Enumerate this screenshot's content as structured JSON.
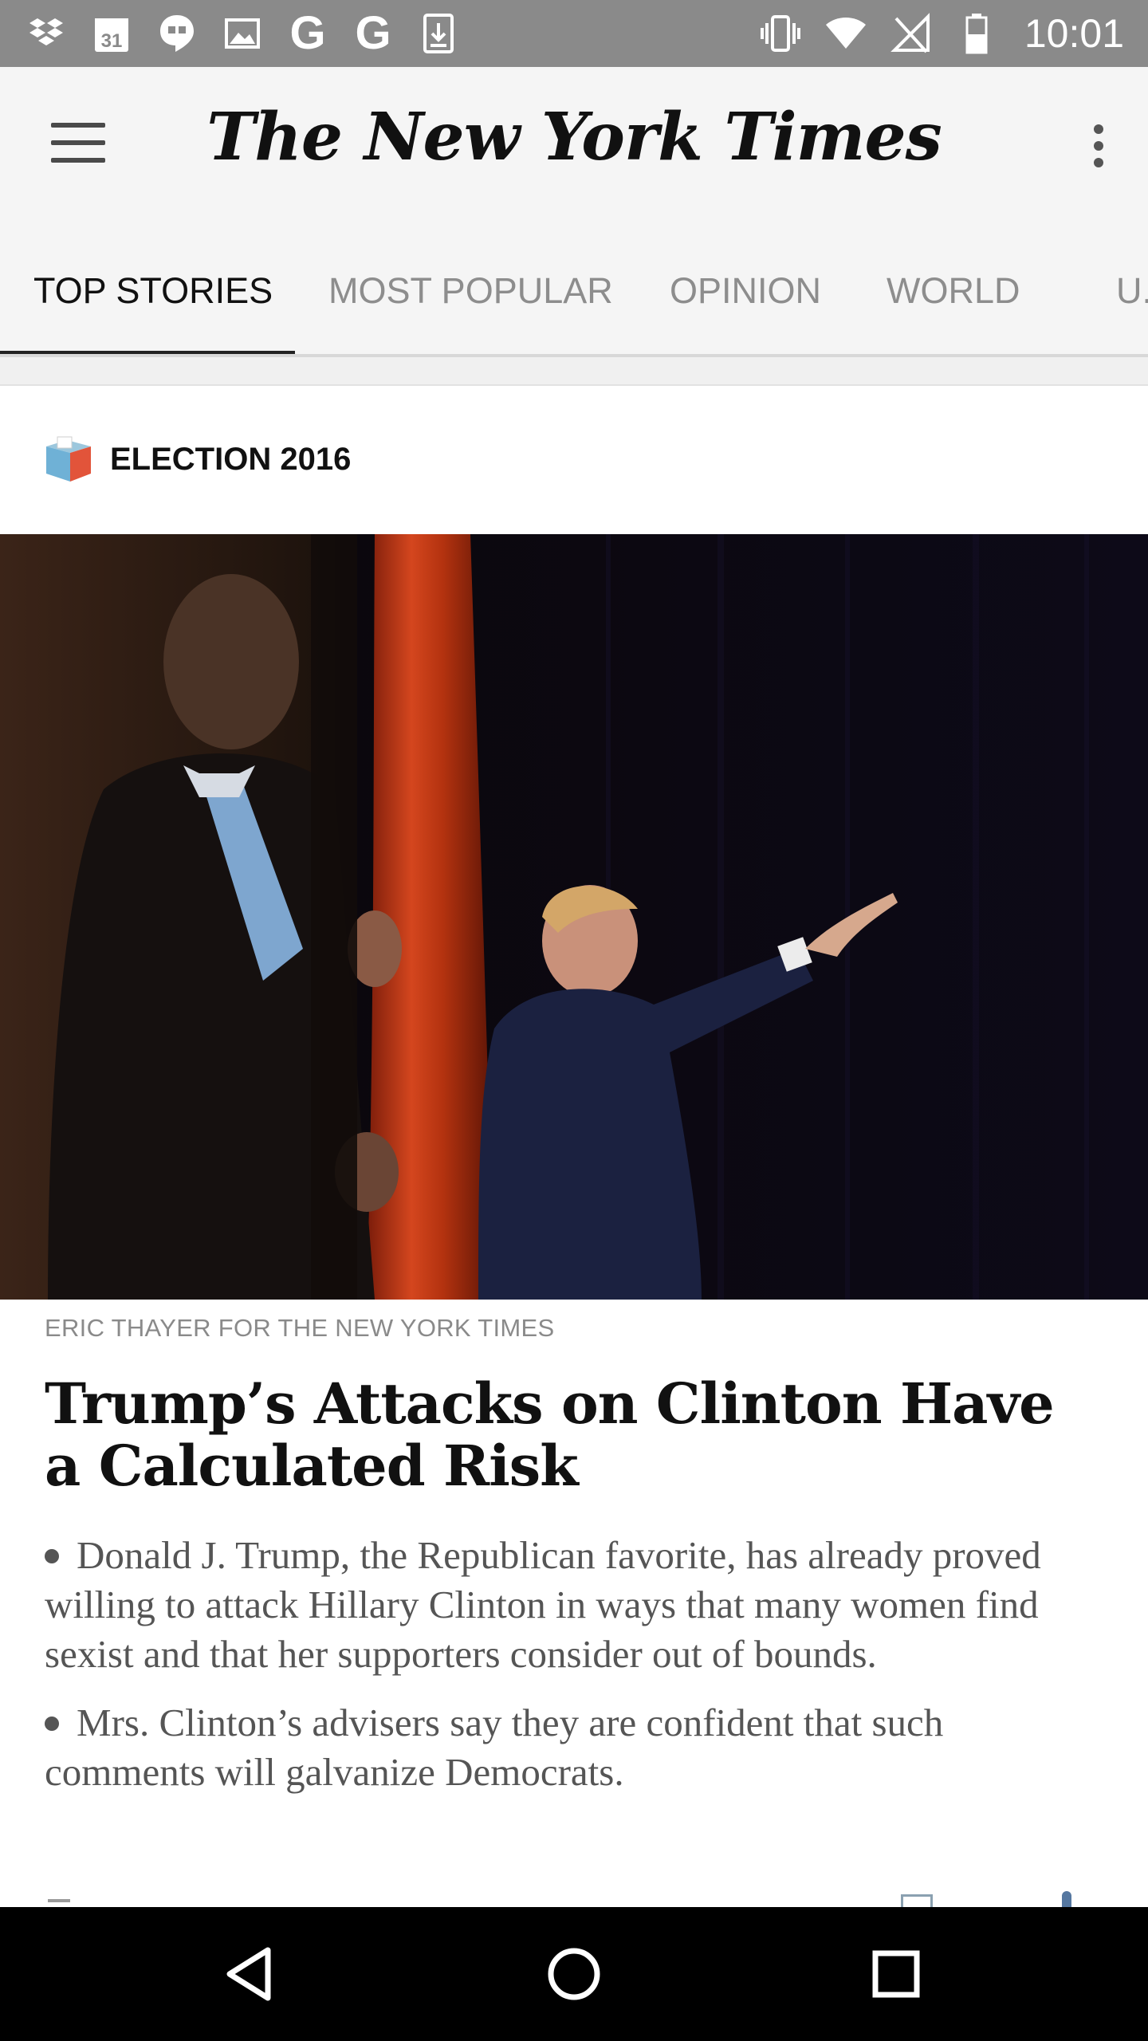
{
  "status_bar": {
    "time": "10:01",
    "left_icons": [
      "dropbox-icon",
      "calendar-icon",
      "hangouts-icon",
      "gallery-icon",
      "google-icon",
      "google-icon",
      "download-icon"
    ],
    "calendar_day": "31",
    "google_letter": "G",
    "right_icons": [
      "vibrate-icon",
      "wifi-icon",
      "no-signal-icon",
      "battery-icon"
    ]
  },
  "app_bar": {
    "title": "The New York Times",
    "menu_icon": "hamburger-menu-icon",
    "overflow_icon": "more-vert-icon"
  },
  "tabs": [
    {
      "label": "TOP STORIES",
      "active": true
    },
    {
      "label": "MOST POPULAR",
      "active": false
    },
    {
      "label": "OPINION",
      "active": false
    },
    {
      "label": "WORLD",
      "active": false
    },
    {
      "label": "U.",
      "active": false
    }
  ],
  "section": {
    "icon": "ballot-box-icon",
    "label": "ELECTION 2016"
  },
  "article": {
    "photo_credit": "ERIC THAYER FOR THE NEW YORK TIMES",
    "headline": "Trump’s Attacks on Clinton Have a Calculated Risk",
    "bullets": [
      "Donald J. Trump, the Republican favorite, has already proved willing to attack Hillary Clinton in ways that many women find sexist and that her supporters consider out of bounds.",
      "Mrs. Clinton’s advisers say they are confident that such comments will galvanize Democrats."
    ]
  },
  "nav_bar": {
    "back_icon": "back-triangle-icon",
    "home_icon": "home-circle-icon",
    "recents_icon": "recents-square-icon"
  },
  "colors": {
    "status_bar": "#8a8a8a",
    "app_bar": "#f5f5f5",
    "tab_active": "#111111",
    "tab_inactive": "#8d8d8d",
    "curtain": "#c83a1a"
  }
}
